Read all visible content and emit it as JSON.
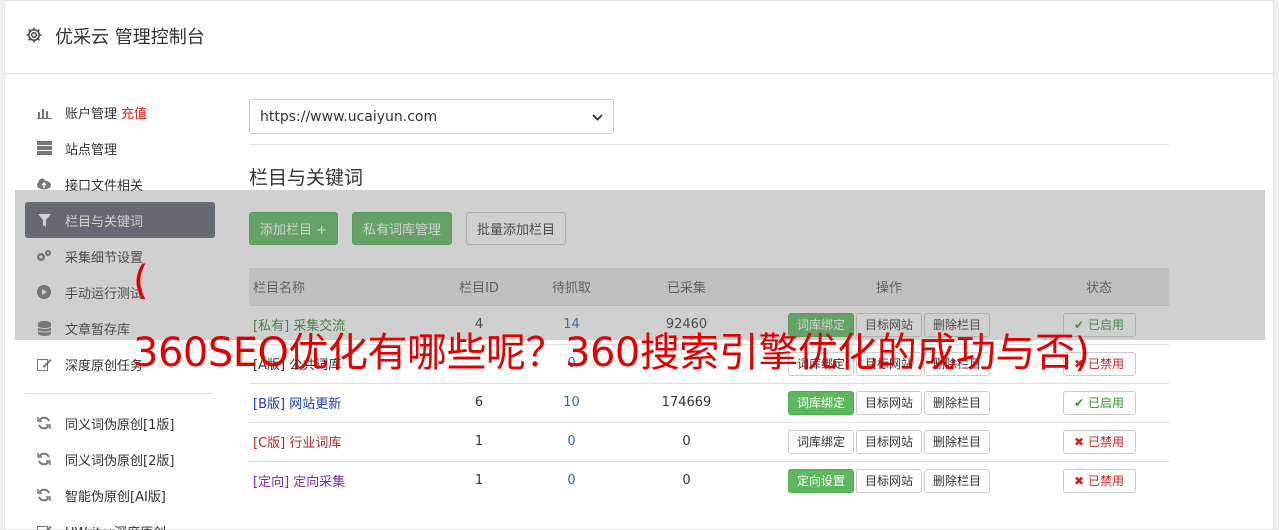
{
  "app": {
    "title": "优采云 管理控制台"
  },
  "sidebar": {
    "items": [
      {
        "label": "账户管理",
        "extra": "充值",
        "icon": "bar-chart-icon"
      },
      {
        "label": "站点管理",
        "icon": "server-icon"
      },
      {
        "label": "接口文件相关",
        "icon": "cloud-upload-icon"
      },
      {
        "label": "栏目与关键词",
        "icon": "filter-icon",
        "active": true
      },
      {
        "label": "采集细节设置",
        "icon": "cogs-icon"
      },
      {
        "label": "手动运行测试",
        "icon": "play-icon"
      },
      {
        "label": "文章暂存库",
        "icon": "database-icon"
      },
      {
        "label": "深度原创任务",
        "icon": "edit-icon"
      }
    ],
    "items2": [
      {
        "label": "同义词伪原创[1版]",
        "icon": "refresh-icon"
      },
      {
        "label": "同义词伪原创[2版]",
        "icon": "refresh-icon"
      },
      {
        "label": "智能伪原创[AI版]",
        "icon": "refresh-icon"
      },
      {
        "label": "UWriter深度原创",
        "icon": "edit-icon"
      }
    ]
  },
  "main": {
    "site_select": "https://www.ucaiyun.com",
    "heading": "栏目与关键词",
    "buttons": {
      "add": "添加栏目 +",
      "private": "私有词库管理",
      "batch": "批量添加栏目"
    },
    "columns": [
      "栏目名称",
      "栏目ID",
      "待抓取",
      "已采集",
      "操作",
      "状态"
    ],
    "rows": [
      {
        "tag": "[私有]",
        "name": "采集交流",
        "id": "4",
        "pending": "14",
        "collected": "92460",
        "op1": "词库绑定",
        "op2": "目标网站",
        "op3": "删除栏目",
        "status": "已启用",
        "color": "#2a8a2a",
        "op1_green": true,
        "enabled": true
      },
      {
        "tag": "[A版]",
        "name": "公共词库",
        "id": "",
        "pending": "0",
        "collected": "",
        "op1": "词库绑定",
        "op2": "目标网站",
        "op3": "删除栏目",
        "status": "已禁用",
        "color": "#333333",
        "op1_green": false,
        "enabled": false
      },
      {
        "tag": "[B版]",
        "name": "网站更新",
        "id": "6",
        "pending": "10",
        "collected": "174669",
        "op1": "词库绑定",
        "op2": "目标网站",
        "op3": "删除栏目",
        "status": "已启用",
        "color": "#1a3ab5",
        "op1_green": true,
        "enabled": true
      },
      {
        "tag": "[C版]",
        "name": "行业词库",
        "id": "1",
        "pending": "0",
        "collected": "0",
        "op1": "词库绑定",
        "op2": "目标网站",
        "op3": "删除栏目",
        "status": "已禁用",
        "color": "#b52a2a",
        "op1_green": false,
        "enabled": false
      },
      {
        "tag": "[定向]",
        "name": "定向采集",
        "id": "1",
        "pending": "0",
        "collected": "0",
        "op1": "定向设置",
        "op2": "目标网站",
        "op3": "删除栏目",
        "status": "已禁用",
        "color": "#7a2ab5",
        "op1_green": true,
        "enabled": false
      }
    ]
  },
  "watermark": {
    "line1": "(",
    "line2": "360SEO优化有哪些呢？360搜索引擎优化的成功与否)"
  }
}
